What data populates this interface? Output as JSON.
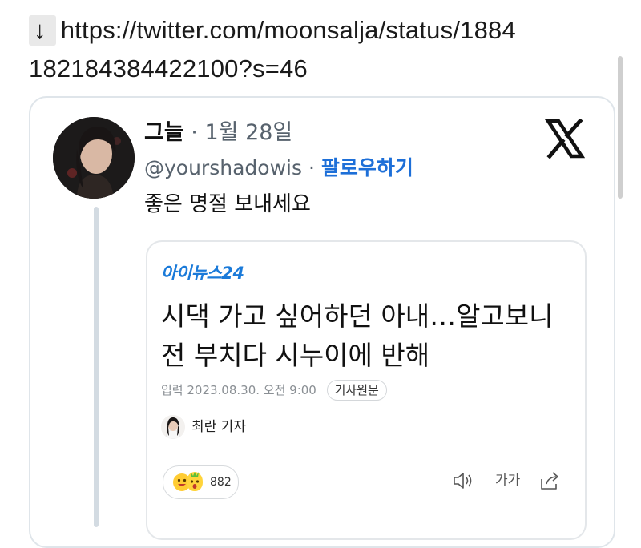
{
  "header": {
    "arrow": "↓",
    "url_line1": "https://twitter.com/moonsalja/status/1884",
    "url_line2": "182184384422100?s=46"
  },
  "tweet": {
    "display_name": "그늘",
    "separator": "·",
    "date": "1월 28일",
    "handle": "@yourshadowis",
    "follow_label": "팔로우하기",
    "text": "좋은 명절 보내세요"
  },
  "article": {
    "publisher": "아이뉴스24",
    "headline_line1": "시댁 가고 싶어하던 아내…알고보니",
    "headline_line2": "전 부치다 시누이에 반해",
    "meta": "입력 2023.08.30. 오전 9:00",
    "original_label": "기사원문",
    "reporter": "최란 기자",
    "reaction_count": "882",
    "font_size_label": "가가"
  },
  "icons": {
    "arrow": "down-arrow-icon",
    "brand": "x-logo-icon",
    "audio": "speaker-icon",
    "font": "font-size-icon",
    "share": "share-icon",
    "reactions": "emoji-reaction-icon"
  },
  "colors": {
    "accent": "#1d6fd8",
    "publisher": "#1a7ad9",
    "secondary_text": "#57626d",
    "border": "#dfe5ea"
  }
}
